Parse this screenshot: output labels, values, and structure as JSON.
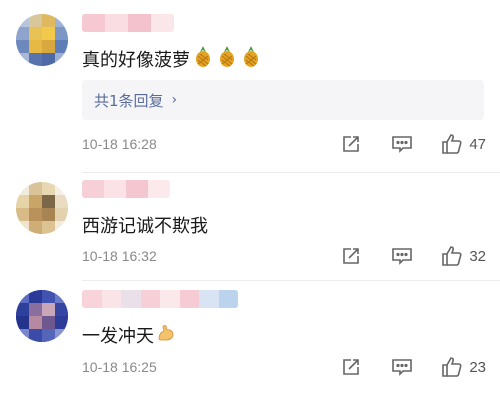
{
  "comments": [
    {
      "text": "真的好像菠萝",
      "emoji": [
        "pineapple-emoji",
        "pineapple-emoji",
        "pineapple-emoji"
      ],
      "reply_label": "共1条回复",
      "reply_chevron": "›",
      "time": "10-18 16:28",
      "likes": "47"
    },
    {
      "text": "西游记诚不欺我",
      "emoji": [],
      "time": "10-18 16:32",
      "likes": "32"
    },
    {
      "text": "一发冲天",
      "emoji": [
        "flexed-biceps-emoji"
      ],
      "time": "10-18 16:25",
      "likes": "23"
    }
  ],
  "colors": {
    "reply_link": "#5a6d9a",
    "meta_text": "#8a8a8a",
    "icon_gray": "#666666"
  }
}
